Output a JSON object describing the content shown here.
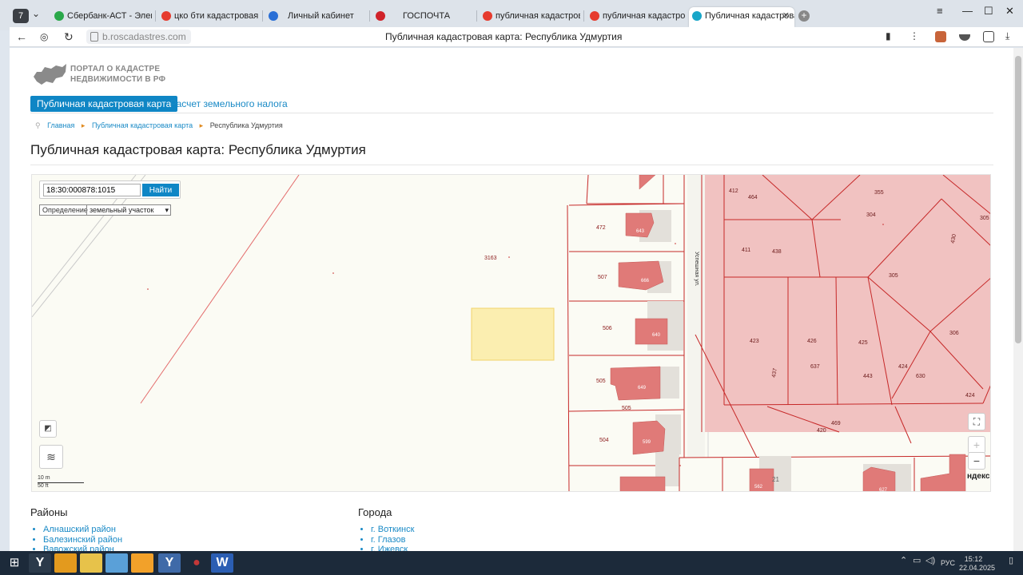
{
  "browser": {
    "tab_count": "7",
    "tabs": [
      {
        "label": "Сбербанк-АСТ - Электро",
        "color": "#2aa84a"
      },
      {
        "label": "цко бти кадастровая сто",
        "color": "#e63b2e"
      },
      {
        "label": "Личный кабинет",
        "color": "#2a6fd6"
      },
      {
        "label": "ГОСПОЧТА",
        "color": "#d0232a"
      },
      {
        "label": "публичная кадастровая к",
        "color": "#e63b2e"
      },
      {
        "label": "публичная кадастровая к",
        "color": "#e63b2e"
      },
      {
        "label": "Публичная кадастровая",
        "color": "#18a6c8"
      }
    ],
    "url": "b.roscadastres.com",
    "page_title": "Публичная кадастровая карта: Республика Удмуртия"
  },
  "site": {
    "logo_line1": "ПОРТАЛ О КАДАСТРЕ",
    "logo_line2": "НЕДВИЖИМОСТИ В РФ",
    "menu": [
      {
        "label": "Публичная кадастровая карта",
        "active": true
      },
      {
        "label": "Расчет земельного налога",
        "active": false
      }
    ],
    "breadcrumbs": [
      "Главная",
      "Публичная кадастровая карта",
      "Республика Удмуртия"
    ],
    "heading": "Публичная кадастровая карта: Республика Удмуртия"
  },
  "map": {
    "search_value": "18:30:000878:1015",
    "search_button": "Найти",
    "definition_label": "Определение",
    "definition_value": "земельный участок",
    "zoom_in": "+",
    "zoom_out": "−",
    "scale_m": "10 m",
    "scale_ft": "50 ft",
    "provider": "ндекс",
    "street": "Успешная ул.",
    "parcels_left": [
      "3163",
      "472",
      "507",
      "506",
      "505",
      "505",
      "504"
    ],
    "buildings_left": [
      "643",
      "666",
      "640",
      "649",
      "599"
    ],
    "parcels_right": [
      "412",
      "464",
      "355",
      "304",
      "411",
      "438",
      "305",
      "430",
      "305",
      "306",
      "423",
      "426",
      "425",
      "637",
      "437",
      "443",
      "424",
      "630",
      "306",
      "424",
      "469",
      "420"
    ],
    "bottom_labels": [
      "562",
      "21",
      "627"
    ]
  },
  "below": {
    "districts_title": "Районы",
    "districts": [
      "Алнашский район",
      "Балезинский район",
      "Вавожский район"
    ],
    "cities_title": "Города",
    "cities": [
      "г. Воткинск",
      "г. Глазов",
      "г. Ижевск"
    ]
  },
  "taskbar": {
    "lang": "РУС",
    "time": "15:12",
    "date": "22.04.2025"
  }
}
